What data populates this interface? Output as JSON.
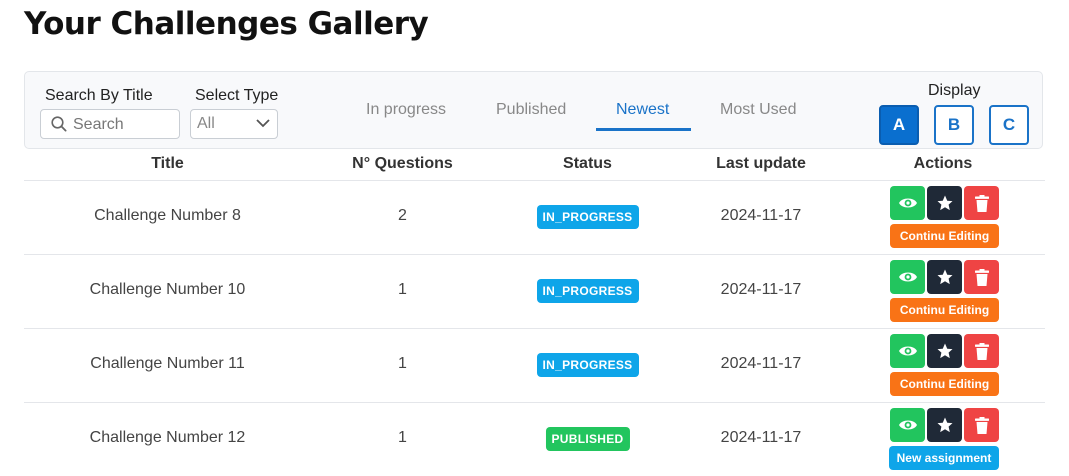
{
  "page": {
    "title": "Your Challenges Gallery"
  },
  "filters": {
    "search_label": "Search By Title",
    "search_placeholder": "Search",
    "type_label": "Select Type",
    "type_value": "All"
  },
  "tabs": [
    {
      "label": "In progress",
      "active": false
    },
    {
      "label": "Published",
      "active": false
    },
    {
      "label": "Newest",
      "active": true
    },
    {
      "label": "Most Used",
      "active": false
    }
  ],
  "display": {
    "label": "Display",
    "options": [
      {
        "label": "A",
        "active": true
      },
      {
        "label": "B",
        "active": false
      },
      {
        "label": "C",
        "active": false
      }
    ]
  },
  "table": {
    "headers": {
      "title": "Title",
      "questions": "N° Questions",
      "status": "Status",
      "last_update": "Last update",
      "actions": "Actions"
    },
    "rows": [
      {
        "title": "Challenge Number 8",
        "questions": "2",
        "status": "IN_PROGRESS",
        "last_update": "2024-11-17",
        "action_label": "Continu Editing"
      },
      {
        "title": "Challenge Number 10",
        "questions": "1",
        "status": "IN_PROGRESS",
        "last_update": "2024-11-17",
        "action_label": "Continu Editing"
      },
      {
        "title": "Challenge Number 11",
        "questions": "1",
        "status": "IN_PROGRESS",
        "last_update": "2024-11-17",
        "action_label": "Continu Editing"
      },
      {
        "title": "Challenge Number 12",
        "questions": "1",
        "status": "PUBLISHED",
        "last_update": "2024-11-17",
        "action_label": "New assignment"
      }
    ]
  },
  "icons": {
    "view": "eye-icon",
    "favorite": "star-icon",
    "delete": "trash-icon",
    "search": "search-icon",
    "dropdown": "chevron-down-icon"
  },
  "colors": {
    "primary": "#1a73c8",
    "in_progress": "#0ea5e9",
    "published": "#22c55e",
    "view": "#22c55e",
    "star": "#1f2937",
    "delete": "#ef4444",
    "continue": "#f97316",
    "new_assignment": "#0ea5e9"
  }
}
